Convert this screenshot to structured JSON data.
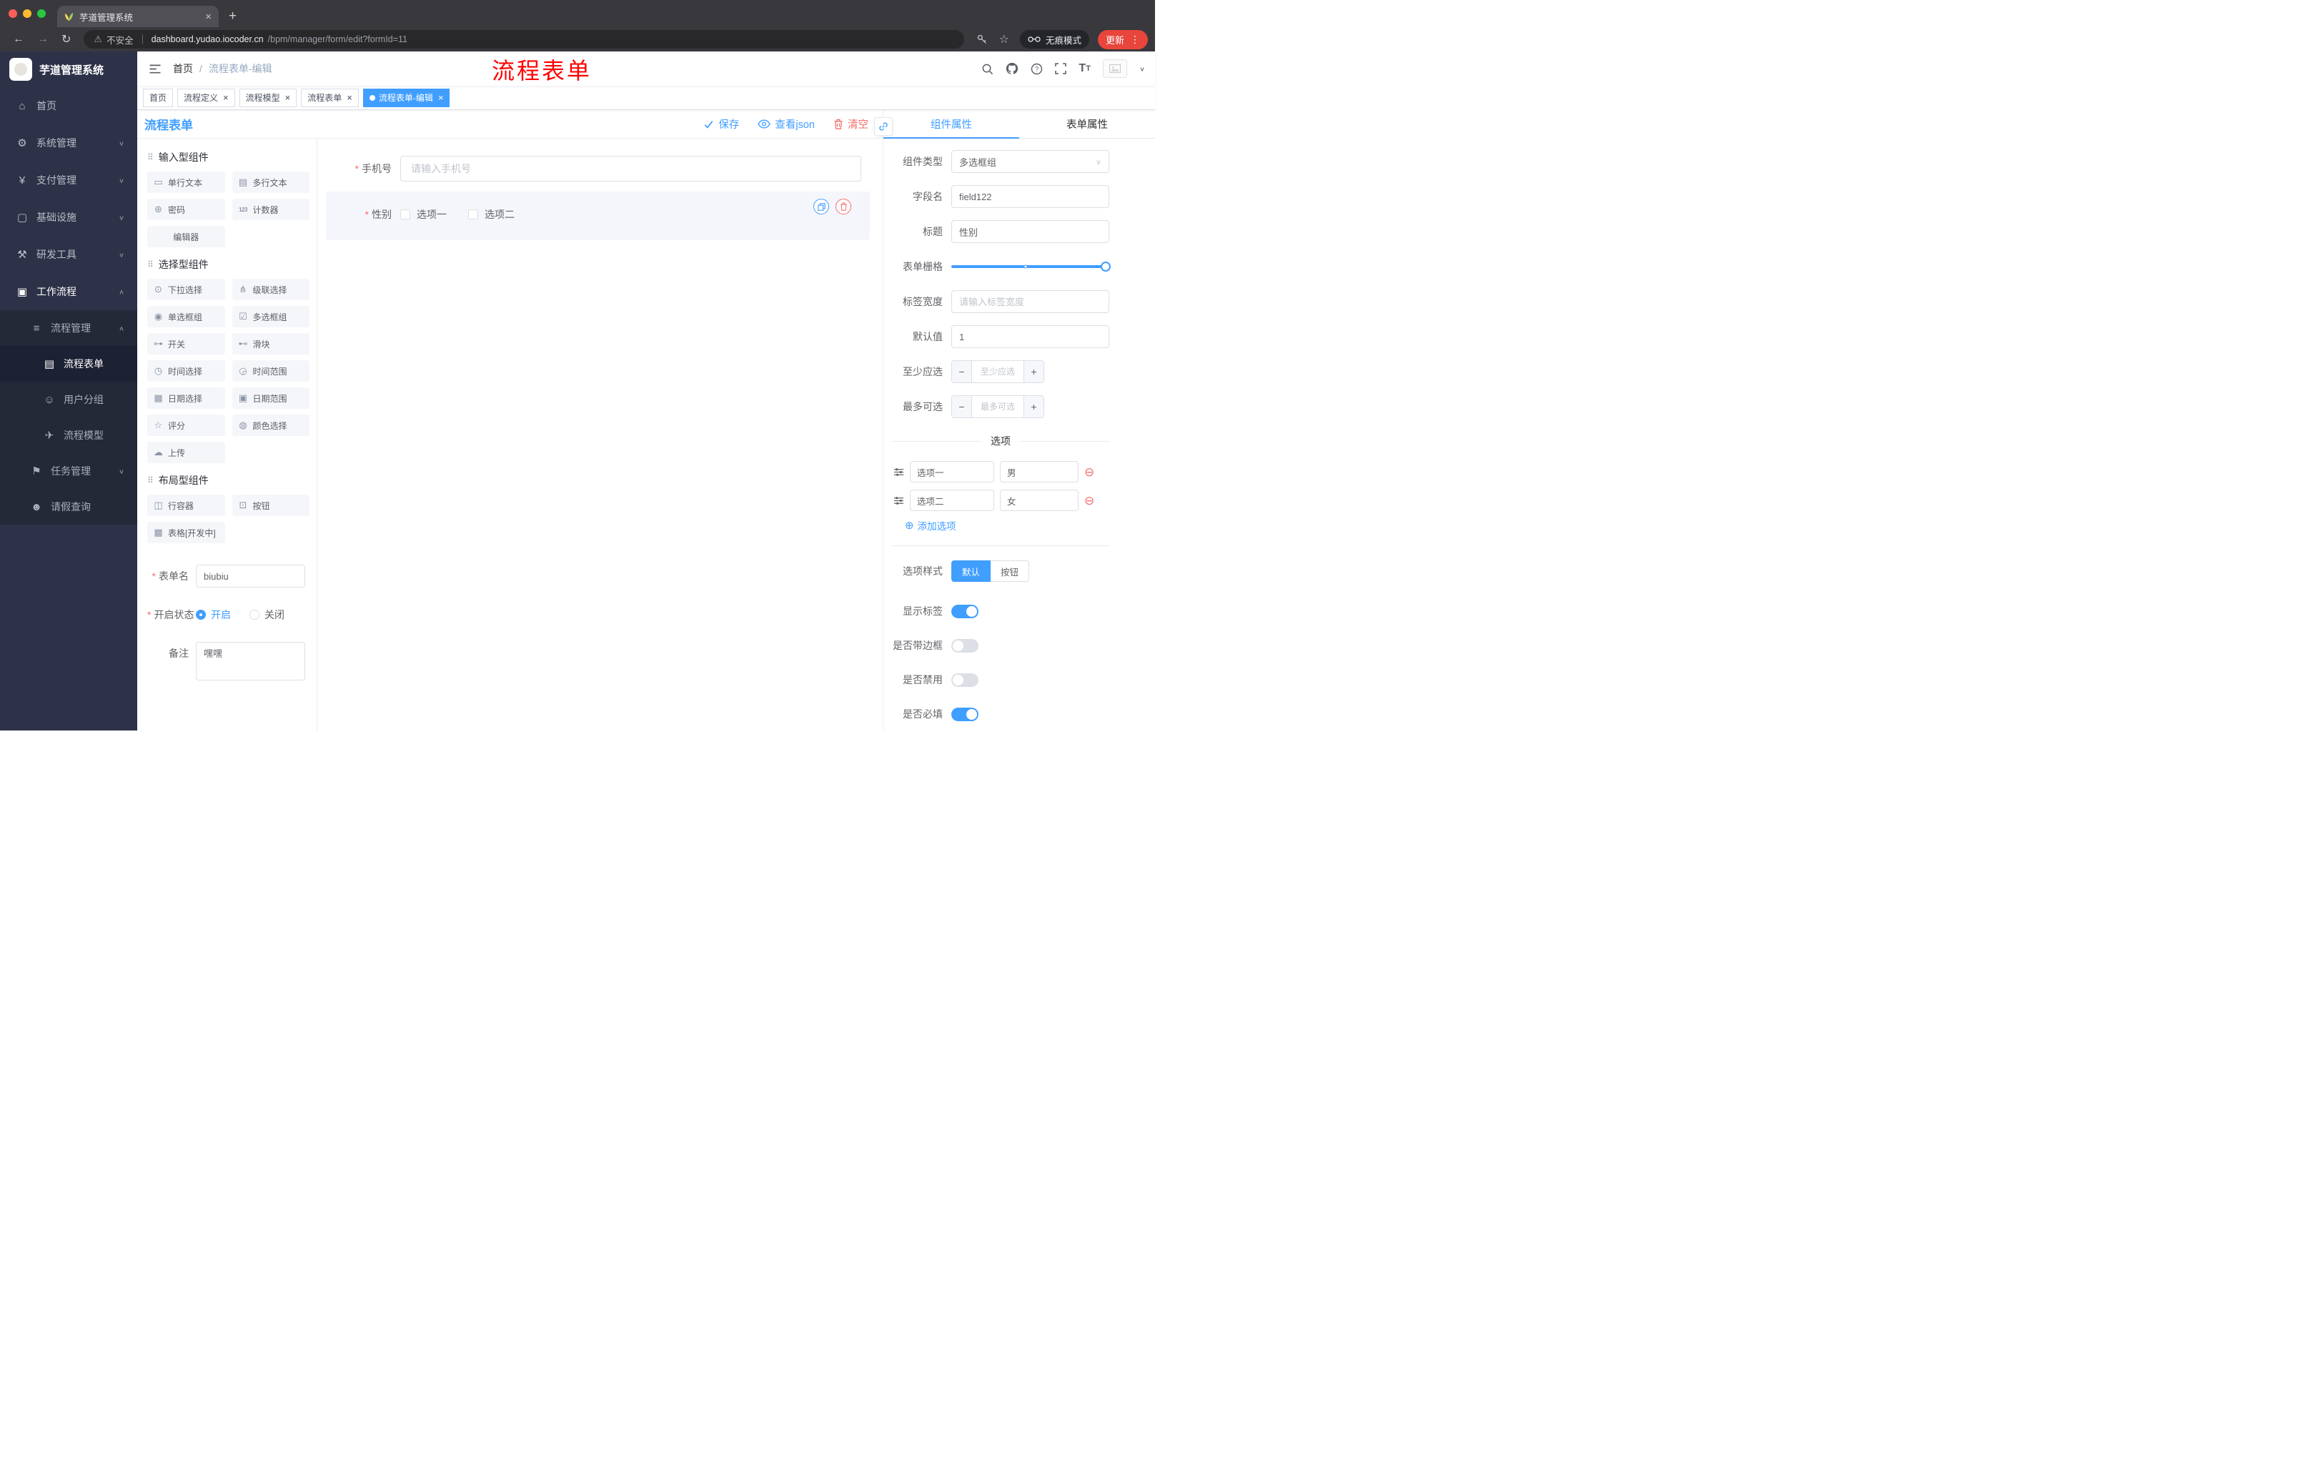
{
  "accent_color": "#409eff",
  "danger_color": "#f56c6c",
  "browser": {
    "tab_title": "芋道管理系统",
    "security_label": "不安全",
    "url_host": "dashboard.yudao.iocoder.cn",
    "url_path": "/bpm/manager/form/edit?formId=11",
    "incognito_label": "无痕模式",
    "update_label": "更新"
  },
  "sidebar": {
    "logo_title": "芋道管理系统",
    "top_items": [
      {
        "key": "home",
        "label": "首页",
        "icon": "dashboard-icon"
      },
      {
        "key": "system",
        "label": "系统管理",
        "icon": "gear-icon",
        "arrow": "down"
      },
      {
        "key": "payment",
        "label": "支付管理",
        "icon": "payment-icon",
        "arrow": "down"
      },
      {
        "key": "infrastructure",
        "label": "基础设施",
        "icon": "infrastructure-icon",
        "arrow": "down"
      },
      {
        "key": "devtools",
        "label": "研发工具",
        "icon": "devtools-icon",
        "arrow": "down"
      },
      {
        "key": "workflow",
        "label": "工作流程",
        "icon": "workflow-icon",
        "arrow": "up",
        "active": true
      }
    ],
    "sub_items": [
      {
        "key": "process-mgmt",
        "label": "流程管理",
        "icon": "list-icon",
        "arrow": "up",
        "level": 1
      },
      {
        "key": "process-form",
        "label": "流程表单",
        "icon": "form-icon",
        "level": 2,
        "active": true
      },
      {
        "key": "user-group",
        "label": "用户分组",
        "icon": "chat-icon",
        "level": 2
      },
      {
        "key": "process-model",
        "label": "流程模型",
        "icon": "send-icon",
        "level": 2
      },
      {
        "key": "task-mgmt",
        "label": "任务管理",
        "icon": "branch-icon",
        "arrow": "down",
        "level": 1
      },
      {
        "key": "leave-query",
        "label": "请假查询",
        "icon": "user-icon",
        "level": 1
      }
    ]
  },
  "header": {
    "breadcrumb_home": "首页",
    "breadcrumb_sep": "/",
    "breadcrumb_current": "流程表单-编辑",
    "overlay_title": "流程表单"
  },
  "tags": [
    {
      "key": "home",
      "label": "首页",
      "closable": false
    },
    {
      "key": "process-definition",
      "label": "流程定义",
      "closable": true
    },
    {
      "key": "process-model",
      "label": "流程模型",
      "closable": true
    },
    {
      "key": "process-form",
      "label": "流程表单",
      "closable": true
    },
    {
      "key": "process-form-edit",
      "label": "流程表单-编辑",
      "closable": true,
      "active": true
    }
  ],
  "designer": {
    "title": "流程表单",
    "save_label": "保存",
    "view_json_label": "查看json",
    "clear_label": "清空"
  },
  "palette": {
    "groups": [
      {
        "title": "输入型组件",
        "items": [
          {
            "key": "single-line-text",
            "label": "单行文本",
            "icon": "input-icon"
          },
          {
            "key": "multi-line-text",
            "label": "多行文本",
            "icon": "textarea-icon"
          },
          {
            "key": "password",
            "label": "密码",
            "icon": "lock-icon"
          },
          {
            "key": "counter",
            "label": "计数器",
            "icon": "counter-icon"
          },
          {
            "key": "editor",
            "label": "编辑器"
          }
        ]
      },
      {
        "title": "选择型组件",
        "items": [
          {
            "key": "select",
            "label": "下拉选择",
            "icon": "select-icon"
          },
          {
            "key": "cascader",
            "label": "级联选择",
            "icon": "cascader-icon"
          },
          {
            "key": "radio-group",
            "label": "单选框组",
            "icon": "radio-icon"
          },
          {
            "key": "checkbox-group",
            "label": "多选框组",
            "icon": "checkbox-icon"
          },
          {
            "key": "switch",
            "label": "开关",
            "icon": "switch-icon"
          },
          {
            "key": "slider",
            "label": "滑块",
            "icon": "slider-icon"
          },
          {
            "key": "time-picker",
            "label": "时间选择",
            "icon": "time-icon"
          },
          {
            "key": "time-range",
            "label": "时间范围",
            "icon": "time-range-icon"
          },
          {
            "key": "date-picker",
            "label": "日期选择",
            "icon": "date-icon"
          },
          {
            "key": "date-range",
            "label": "日期范围",
            "icon": "date-range-icon"
          },
          {
            "key": "rate",
            "label": "评分",
            "icon": "star-icon"
          },
          {
            "key": "color-picker",
            "label": "颜色选择",
            "icon": "color-icon"
          },
          {
            "key": "upload",
            "label": "上传",
            "icon": "upload-icon"
          }
        ]
      },
      {
        "title": "布局型组件",
        "items": [
          {
            "key": "row-container",
            "label": "行容器",
            "icon": "row-icon"
          },
          {
            "key": "button",
            "label": "按钮",
            "icon": "button-icon"
          },
          {
            "key": "table",
            "label": "表格[开发中]",
            "icon": "table-icon"
          }
        ]
      }
    ],
    "form": {
      "name_label": "表单名",
      "name_value": "biubiu",
      "status_label": "开启状态",
      "status_on": "开启",
      "status_off": "关闭",
      "remark_label": "备注",
      "remark_value": "嘿嘿"
    }
  },
  "canvas": {
    "phone_field": {
      "label": "手机号",
      "placeholder": "请输入手机号",
      "required": true
    },
    "gender_field": {
      "label": "性别",
      "required": true,
      "options": [
        "选项一",
        "选项二"
      ],
      "selected": true
    }
  },
  "props": {
    "tab_component": "组件属性",
    "tab_form": "表单属性",
    "component_type_label": "组件类型",
    "component_type_value": "多选框组",
    "field_name_label": "字段名",
    "field_name_value": "field122",
    "title_label": "标题",
    "title_value": "性别",
    "grid_label": "表单栅格",
    "label_width_label": "标签宽度",
    "label_width_placeholder": "请输入标签宽度",
    "default_label": "默认值",
    "default_value": "1",
    "min_select_label": "至少应选",
    "min_select_placeholder": "至少应选",
    "max_select_label": "最多可选",
    "max_select_placeholder": "最多可选",
    "options_divider": "选项",
    "options": [
      {
        "label": "选项一",
        "value": "男"
      },
      {
        "label": "选项二",
        "value": "女"
      }
    ],
    "add_option_label": "添加选项",
    "option_style_label": "选项样式",
    "option_style_default": "默认",
    "option_style_button": "按钮",
    "toggles": [
      {
        "key": "show-label",
        "label": "显示标签",
        "on": true
      },
      {
        "key": "with-border",
        "label": "是否带边框",
        "on": false
      },
      {
        "key": "disabled",
        "label": "是否禁用",
        "on": false
      },
      {
        "key": "required",
        "label": "是否必填",
        "on": true
      }
    ]
  }
}
